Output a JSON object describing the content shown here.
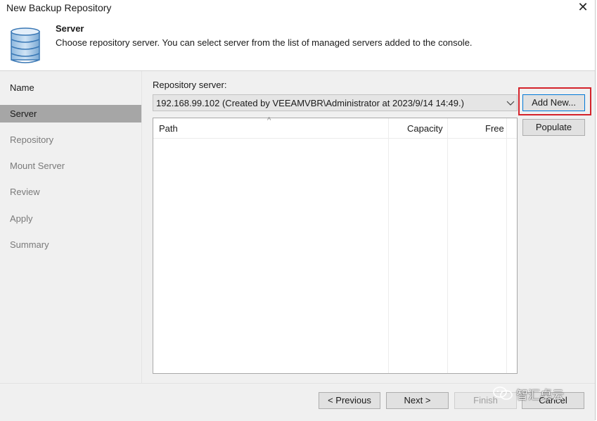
{
  "window": {
    "title": "New Backup Repository",
    "close_glyph": "✕"
  },
  "header": {
    "title": "Server",
    "description": "Choose repository server. You can select server from the list of managed servers added to the console.",
    "icon": "database-icon"
  },
  "sidebar": {
    "items": [
      {
        "label": "Name",
        "state": "done"
      },
      {
        "label": "Server",
        "state": "active"
      },
      {
        "label": "Repository",
        "state": "pending"
      },
      {
        "label": "Mount Server",
        "state": "pending"
      },
      {
        "label": "Review",
        "state": "pending"
      },
      {
        "label": "Apply",
        "state": "pending"
      },
      {
        "label": "Summary",
        "state": "pending"
      }
    ]
  },
  "main": {
    "repo_server_label": "Repository server:",
    "server_select_value": "192.168.99.102 (Created by VEEAMVBR\\Administrator at 2023/9/14 14:49.)",
    "add_new_label": "Add New...",
    "populate_label": "Populate",
    "table": {
      "columns": [
        "Path",
        "Capacity",
        "Free"
      ],
      "rows": []
    }
  },
  "footer": {
    "previous_label": "< Previous",
    "next_label": "Next >",
    "finish_label": "Finish",
    "cancel_label": "Cancel"
  },
  "watermark": {
    "text": "智汇桌云"
  },
  "colors": {
    "highlight_border": "#d4232b",
    "active_nav": "#a6a6a6",
    "panel_bg": "#f0f0f0"
  }
}
